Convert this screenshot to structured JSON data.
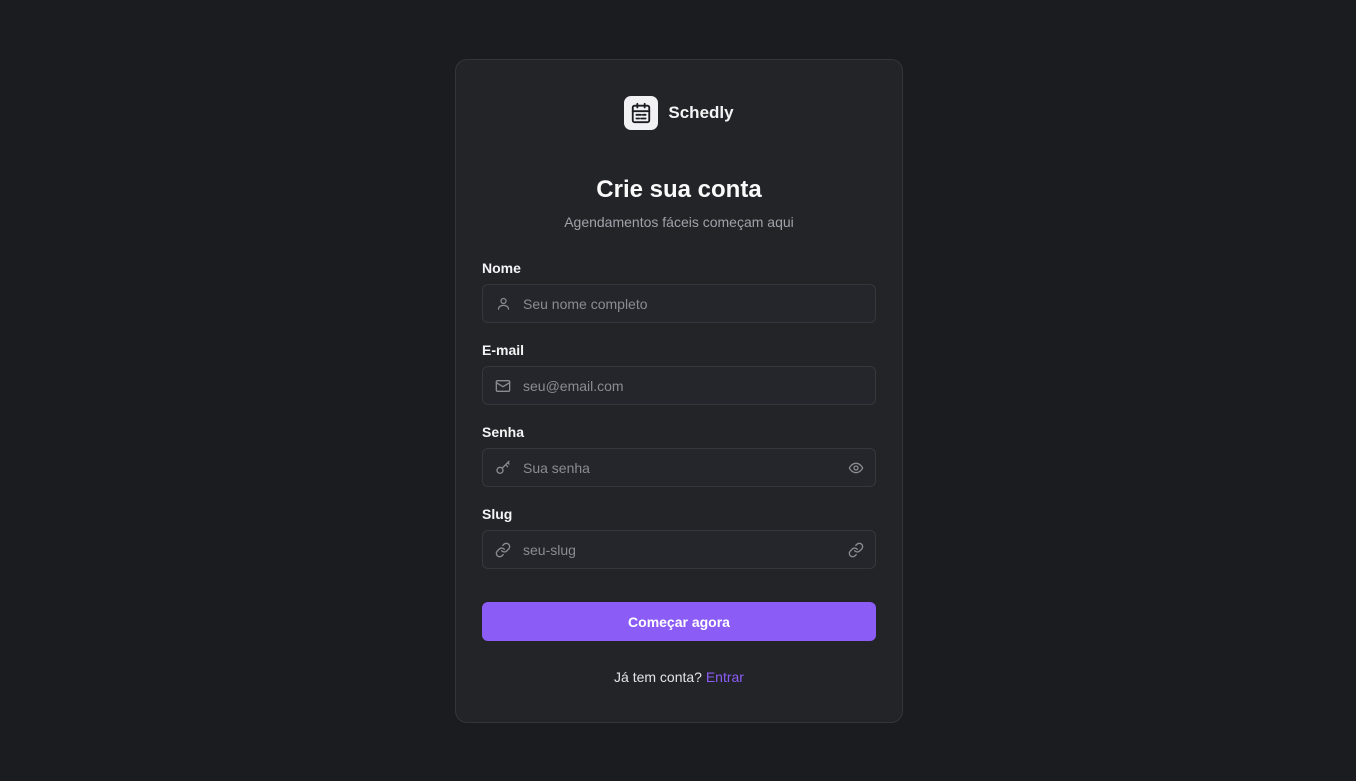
{
  "brand": {
    "name": "Schedly",
    "logo_icon": "calendar-icon"
  },
  "header": {
    "title": "Crie sua conta",
    "subtitle": "Agendamentos fáceis começam aqui"
  },
  "form": {
    "name": {
      "label": "Nome",
      "placeholder": "Seu nome completo",
      "value": "",
      "icon": "user-icon"
    },
    "email": {
      "label": "E-mail",
      "placeholder": "seu@email.com",
      "value": "",
      "icon": "mail-icon"
    },
    "password": {
      "label": "Senha",
      "placeholder": "Sua senha",
      "value": "",
      "icon": "key-icon",
      "toggle_icon": "eye-icon"
    },
    "slug": {
      "label": "Slug",
      "placeholder": "seu-slug",
      "value": "",
      "icon": "link-icon",
      "right_icon": "link-icon"
    },
    "submit_label": "Começar agora"
  },
  "footer": {
    "prompt": "Já tem conta?",
    "link_label": "Entrar"
  },
  "colors": {
    "background": "#1b1c20",
    "card": "#232428",
    "accent": "#8b5cf6",
    "muted_text": "#a1a1aa"
  }
}
